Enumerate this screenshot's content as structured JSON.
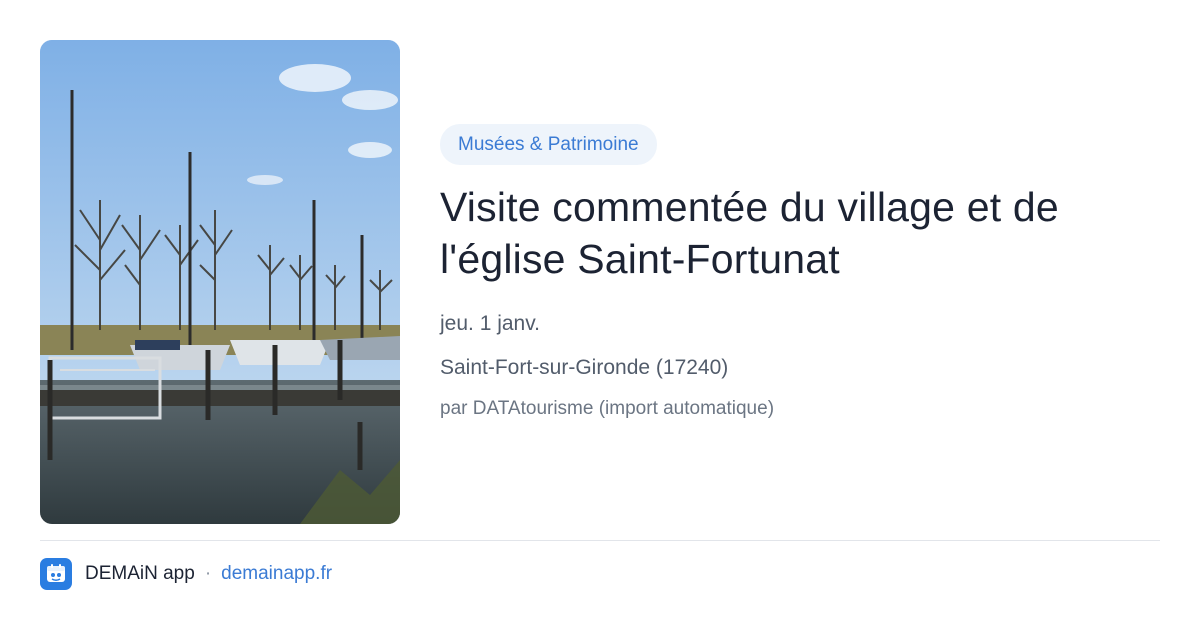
{
  "event": {
    "category": "Musées & Patrimoine",
    "title": "Visite commentée du village et de l'église Saint-Fortunat",
    "date": "jeu. 1 janv.",
    "location": "Saint-Fort-sur-Gironde (17240)",
    "source": "par DATAtourisme (import automatique)",
    "image_icon": "harbor-photo"
  },
  "footer": {
    "app_name": "DEMAiN app",
    "separator": "·",
    "domain": "demainapp.fr",
    "logo_icon": "demain-app-logo-icon"
  },
  "colors": {
    "accent": "#3b7bd4",
    "badge_bg": "#eef4fb",
    "text_primary": "#1c2333",
    "text_secondary": "#525c6b",
    "logo_bg": "#2a7de1"
  }
}
